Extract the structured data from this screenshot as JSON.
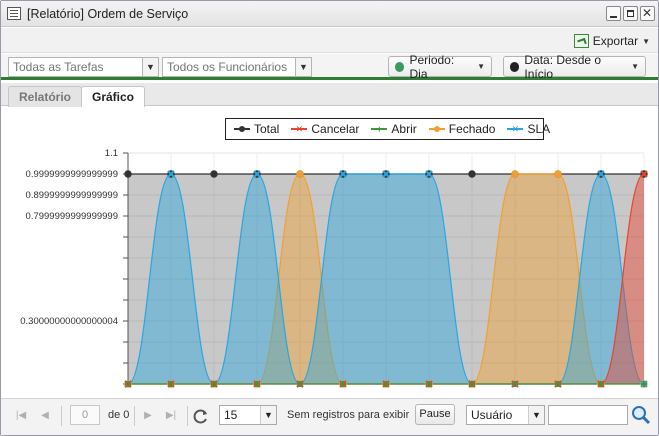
{
  "window": {
    "title": "[Relatório] Ordem de Serviço"
  },
  "toolbar": {
    "export_label": "Exportar"
  },
  "filters": {
    "tasks_placeholder": "Todas as Tarefas",
    "employees_placeholder": "Todos os Funcionários",
    "period_label": "Periodo: Dia",
    "period_color": "#3c9a5f",
    "date_label": "Data: Desde o Início",
    "date_color": "#222222"
  },
  "tabs": [
    {
      "label": "Relatório",
      "active": false
    },
    {
      "label": "Gráfico",
      "active": true
    }
  ],
  "chart_data": {
    "type": "area",
    "x_count": 13,
    "y_ticks": [
      "1.1",
      "0.9999999999999999",
      "0.8999999999999999",
      "0.7999999999999999",
      "0.30000000000000004"
    ],
    "y_tick_values": [
      1.1,
      1.0,
      0.9,
      0.8,
      0.3
    ],
    "ylim": [
      0,
      1.1
    ],
    "grid": true,
    "legend_position": "top",
    "series": [
      {
        "name": "Total",
        "color": "#333333",
        "marker": "circle",
        "values": [
          1,
          1,
          1,
          1,
          1,
          1,
          1,
          1,
          1,
          1,
          1,
          1,
          1
        ]
      },
      {
        "name": "Cancelar",
        "color": "#e8442f",
        "marker": "x",
        "values": [
          0,
          0,
          0,
          0,
          0,
          0,
          0,
          0,
          0,
          0,
          0,
          0,
          1
        ]
      },
      {
        "name": "Abrir",
        "color": "#3a9a3a",
        "marker": "plus",
        "values": [
          0,
          0,
          0,
          0,
          0,
          0,
          0,
          0,
          0,
          0,
          0,
          0,
          0
        ]
      },
      {
        "name": "Fechado",
        "color": "#f0a030",
        "marker": "circle",
        "values": [
          0,
          0,
          0,
          0,
          1,
          0,
          0,
          0,
          0,
          1,
          1,
          0,
          0
        ]
      },
      {
        "name": "SLA",
        "color": "#2aa6e0",
        "marker": "x",
        "values": [
          0,
          1,
          0,
          1,
          0,
          1,
          1,
          1,
          0,
          0,
          0,
          1,
          0
        ]
      }
    ]
  },
  "pager": {
    "page_value": "0",
    "of_label": "de 0",
    "page_size": "15",
    "empty_msg": "Sem registros para exibir",
    "pause_label": "Pause",
    "search_field": "Usuário"
  }
}
